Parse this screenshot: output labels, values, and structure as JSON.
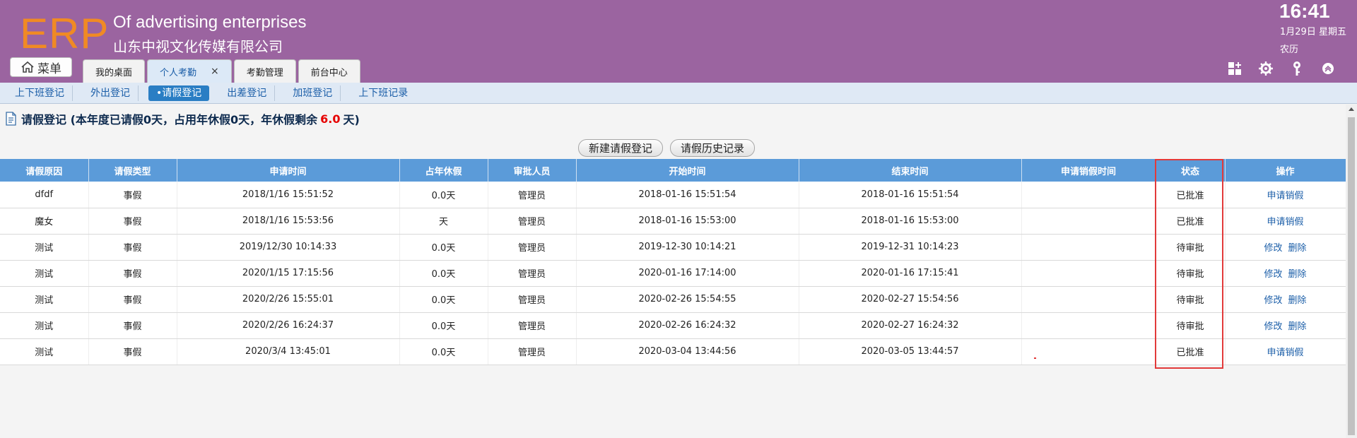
{
  "header": {
    "logo": "ERP",
    "company_en": "Of advertising enterprises",
    "company_cn": "山东中视文化传媒有限公司",
    "time": "16:41",
    "date": "1月29日 星期五",
    "lunar": "农历"
  },
  "menu_label": "菜单",
  "tabs": [
    {
      "label": "我的桌面"
    },
    {
      "label": "个人考勤",
      "close": "×"
    },
    {
      "label": "考勤管理"
    },
    {
      "label": "前台中心"
    }
  ],
  "header_icons": [
    "add-app-icon",
    "gear-icon",
    "key-icon",
    "collapse-up-icon"
  ],
  "subnav": [
    {
      "label": "上下班登记"
    },
    {
      "label": "外出登记"
    },
    {
      "label": "•请假登记"
    },
    {
      "label": "出差登记"
    },
    {
      "label": "加班登记"
    },
    {
      "label": "上下班记录"
    }
  ],
  "page_title": {
    "prefix": "请假登记 (本年度已请假0天，占用年休假0天，年休假剩余",
    "remaining": "6.0",
    "suffix": "天)"
  },
  "buttons": {
    "new": "新建请假登记",
    "history": "请假历史记录"
  },
  "columns": [
    "请假原因",
    "请假类型",
    "申请时间",
    "占年休假",
    "审批人员",
    "开始时间",
    "结束时间",
    "申请销假时间",
    "状态",
    "操作"
  ],
  "rows": [
    {
      "reason": "dfdf",
      "type": "事假",
      "apply": "2018/1/16 15:51:52",
      "annual": "0.0天",
      "approver": "管理员",
      "start": "2018-01-16 15:51:54",
      "end": "2018-01-16 15:51:54",
      "cancel_time": "",
      "status": "已批准",
      "ops": [
        "申请销假"
      ]
    },
    {
      "reason": "魔女",
      "type": "事假",
      "apply": "2018/1/16 15:53:56",
      "annual": "天",
      "approver": "管理员",
      "start": "2018-01-16 15:53:00",
      "end": "2018-01-16 15:53:00",
      "cancel_time": "",
      "status": "已批准",
      "ops": [
        "申请销假"
      ]
    },
    {
      "reason": "测试",
      "type": "事假",
      "apply": "2019/12/30 10:14:33",
      "annual": "0.0天",
      "approver": "管理员",
      "start": "2019-12-30 10:14:21",
      "end": "2019-12-31 10:14:23",
      "cancel_time": "",
      "status": "待审批",
      "ops": [
        "修改",
        "删除"
      ]
    },
    {
      "reason": "测试",
      "type": "事假",
      "apply": "2020/1/15 17:15:56",
      "annual": "0.0天",
      "approver": "管理员",
      "start": "2020-01-16 17:14:00",
      "end": "2020-01-16 17:15:41",
      "cancel_time": "",
      "status": "待审批",
      "ops": [
        "修改",
        "删除"
      ]
    },
    {
      "reason": "测试",
      "type": "事假",
      "apply": "2020/2/26 15:55:01",
      "annual": "0.0天",
      "approver": "管理员",
      "start": "2020-02-26 15:54:55",
      "end": "2020-02-27 15:54:56",
      "cancel_time": "",
      "status": "待审批",
      "ops": [
        "修改",
        "删除"
      ]
    },
    {
      "reason": "测试",
      "type": "事假",
      "apply": "2020/2/26 16:24:37",
      "annual": "0.0天",
      "approver": "管理员",
      "start": "2020-02-26 16:24:32",
      "end": "2020-02-27 16:24:32",
      "cancel_time": "",
      "status": "待审批",
      "ops": [
        "修改",
        "删除"
      ]
    },
    {
      "reason": "测试",
      "type": "事假",
      "apply": "2020/3/4 13:45:01",
      "annual": "0.0天",
      "approver": "管理员",
      "start": "2020-03-04 13:44:56",
      "end": "2020-03-05 13:44:57",
      "cancel_time": "",
      "status": "已批准",
      "ops": [
        "申请销假"
      ]
    }
  ],
  "colors": {
    "header_bg": "#9b64a0",
    "logo": "#f08a24",
    "table_header": "#5b9bd9",
    "approved": "#1a8a1a",
    "highlight": "#e23a3a"
  }
}
